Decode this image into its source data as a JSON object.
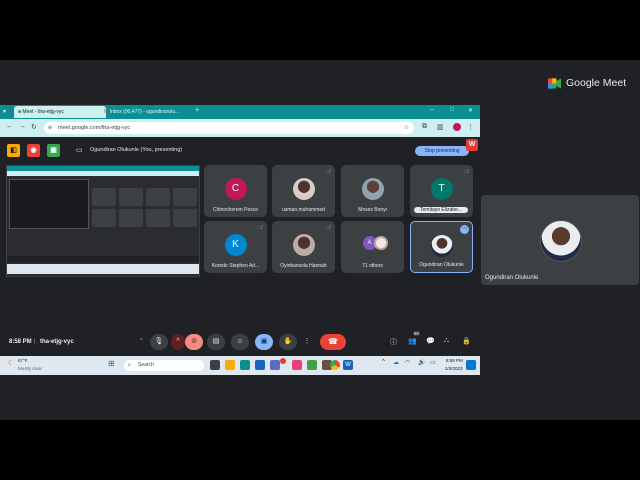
{
  "outer": {
    "logo_text": "Google Meet",
    "self_name": "Ogundiran Olukunle"
  },
  "browser": {
    "tabs": [
      {
        "label": "Meet - tha-etjg-vyc"
      },
      {
        "label": "Inbox (90,477) - ogundiranolu..."
      }
    ],
    "url": "meet.google.com/tha-etjg-vyc"
  },
  "meet": {
    "presenting_label": "Ogundiran Olukunle (You, presenting)",
    "stop_presenting": "Stop presenting",
    "participants": [
      {
        "name": "Chinecherem Pesce",
        "initial": "C",
        "color": "#c2185b"
      },
      {
        "name": "usman muhammed",
        "initial": "",
        "color": "#6d4c41"
      },
      {
        "name": "Moses Bonyi",
        "initial": "",
        "color": "#5d4037"
      },
      {
        "name": "Temitayo Elizabe...",
        "initial": "T",
        "color": "#00796b"
      },
      {
        "name": "Korede Stephen Ad...",
        "initial": "K",
        "color": "#0288d1"
      },
      {
        "name": "Oyinkansola Hannah",
        "initial": "",
        "color": "#8d6e63"
      },
      {
        "name": "71 others",
        "initial": "A",
        "color": "#7e57c2"
      },
      {
        "name": "Ogundiran Olukunle",
        "initial": "",
        "color": "#1f2c44"
      }
    ],
    "clock": "8:58 PM",
    "meeting_code": "tha-etjg-vyc",
    "participant_count": "80"
  },
  "taskbar": {
    "search_placeholder": "Search",
    "weather_temp": "67°F",
    "weather_desc": "Mostly clear",
    "time": "8:58 PM",
    "date": "2/3/2023"
  },
  "icons": {
    "mic": "mic-icon",
    "camera_off": "camera-off-icon",
    "captions": "captions-icon",
    "emoji": "emoji-icon",
    "present": "present-icon",
    "hand": "raise-hand-icon",
    "more": "more-icon",
    "end_call": "end-call-icon"
  },
  "colors": {
    "tab_bar": "#0b8f92",
    "accent_blue": "#8ab4f8",
    "end_call": "#ea4335"
  }
}
